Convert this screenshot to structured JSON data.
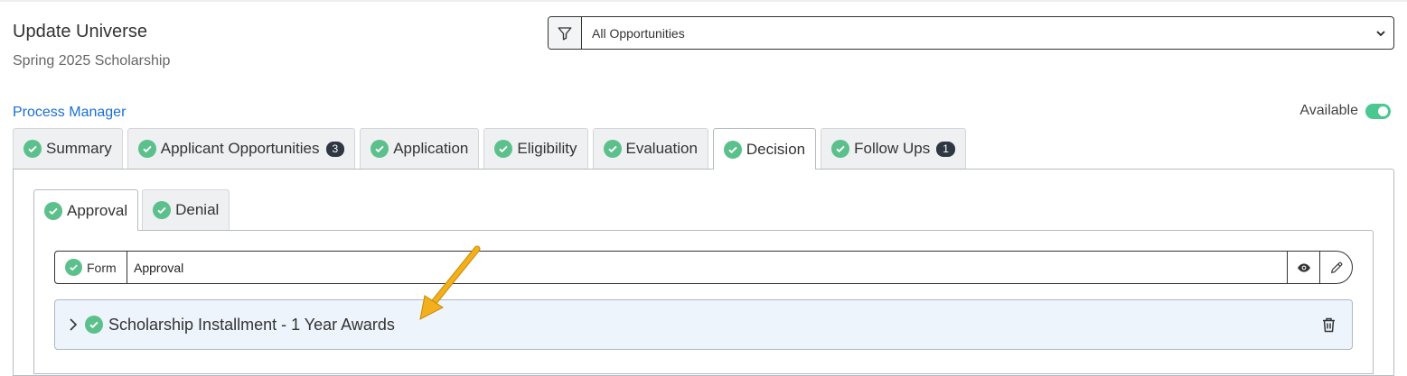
{
  "header": {
    "title": "Update Universe",
    "subtitle": "Spring 2025 Scholarship"
  },
  "filter": {
    "icon": "filter-icon",
    "selected": "All Opportunities"
  },
  "process_manager_label": "Process Manager",
  "availability": {
    "label": "Available",
    "enabled": true,
    "color": "#4cc790"
  },
  "tabs": [
    {
      "label": "Summary"
    },
    {
      "label": "Applicant Opportunities",
      "badge": "3"
    },
    {
      "label": "Application"
    },
    {
      "label": "Eligibility"
    },
    {
      "label": "Evaluation"
    },
    {
      "label": "Decision",
      "active": true
    },
    {
      "label": "Follow Ups",
      "badge": "1"
    }
  ],
  "subtabs": [
    {
      "label": "Approval",
      "active": true
    },
    {
      "label": "Denial"
    }
  ],
  "form": {
    "label": "Form",
    "value": "Approval"
  },
  "installment": {
    "label": "Scholarship Installment - 1 Year Awards"
  },
  "colors": {
    "check": "#5cc08c",
    "link": "#1a6fd1",
    "badge": "#2f3842",
    "annotation_arrow": "#f2b01e"
  }
}
